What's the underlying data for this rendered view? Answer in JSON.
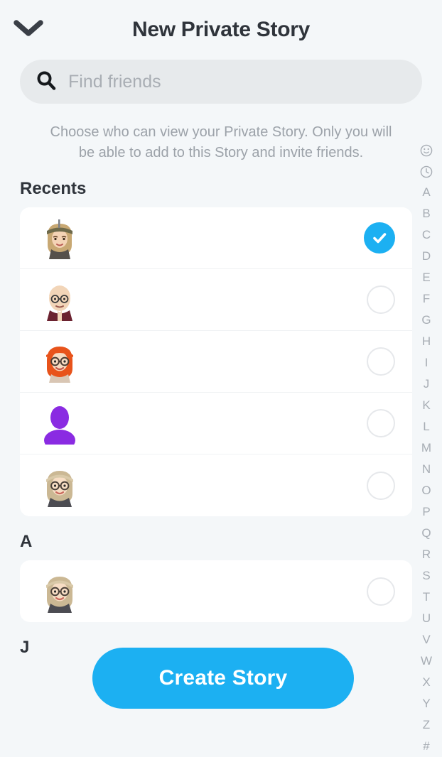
{
  "header": {
    "title": "New Private Story",
    "back_icon": "chevron-down-icon"
  },
  "search": {
    "placeholder": "Find friends",
    "value": "",
    "icon": "search-icon"
  },
  "description": "Choose who can view your Private Story. Only you will be able to add to this Story and invite friends.",
  "sections": [
    {
      "header": "Recents",
      "rows": [
        {
          "name": "",
          "avatar": "bitmoji-woman-headband",
          "selected": true
        },
        {
          "name": "",
          "avatar": "bitmoji-bald-man-glasses",
          "selected": false
        },
        {
          "name": "",
          "avatar": "bitmoji-redhead-woman-glasses",
          "selected": false
        },
        {
          "name": "",
          "avatar": "default-purple-silhouette",
          "selected": false
        },
        {
          "name": "",
          "avatar": "bitmoji-blonde-woman-glasses",
          "selected": false
        }
      ]
    },
    {
      "header": "A",
      "rows": [
        {
          "name": "",
          "avatar": "bitmoji-blonde-woman-glasses",
          "selected": false
        }
      ]
    },
    {
      "header": "J",
      "rows": []
    }
  ],
  "alpha_index": [
    "smiley-icon",
    "clock-icon",
    "A",
    "B",
    "C",
    "D",
    "E",
    "F",
    "G",
    "H",
    "I",
    "J",
    "K",
    "L",
    "M",
    "N",
    "O",
    "P",
    "Q",
    "R",
    "S",
    "T",
    "U",
    "V",
    "W",
    "X",
    "Y",
    "Z",
    "#"
  ],
  "create_story_button": "Create Story",
  "colors": {
    "accent": "#1CB0F2",
    "background": "#F4F7F9",
    "card": "#FFFFFF",
    "search_bar": "#E7EAEC",
    "text_primary": "#2F343B",
    "text_muted": "#9CA2A9",
    "index_text": "#A7ADB4"
  }
}
